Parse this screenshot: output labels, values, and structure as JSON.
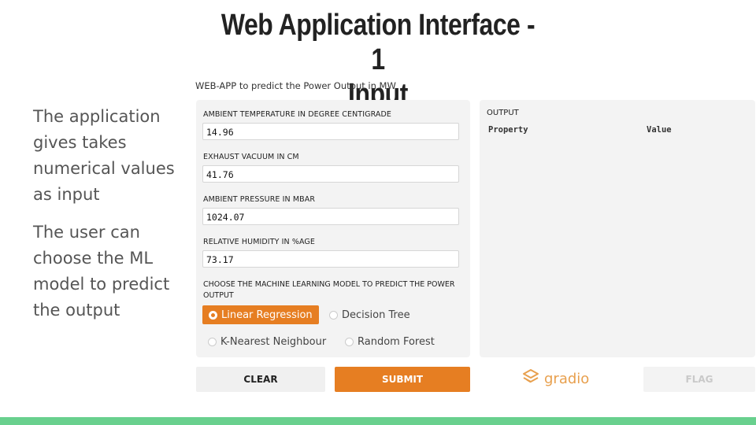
{
  "slide": {
    "title_line1": "Web Application Interface - 1",
    "title_line2": "Input",
    "side_text": [
      "The application gives takes numerical values as input",
      "The user can choose the ML model to predict the output"
    ]
  },
  "app": {
    "subtitle": "WEB-APP to predict the Power Output in MW",
    "inputs": [
      {
        "label": "AMBIENT TEMPERATURE IN DEGREE CENTIGRADE",
        "value": "14.96"
      },
      {
        "label": "EXHAUST VACUUM IN CM",
        "value": "41.76"
      },
      {
        "label": "AMBIENT PRESSURE IN MBAR",
        "value": "1024.07"
      },
      {
        "label": "RELATIVE HUMIDITY IN %AGE",
        "value": "73.17"
      }
    ],
    "model_choice": {
      "label": "CHOOSE THE MACHINE LEARNING MODEL TO PREDICT THE POWER OUTPUT",
      "options": [
        "Linear Regression",
        "Decision Tree",
        "K-Nearest Neighbour",
        "Random Forest"
      ],
      "selected": "Linear Regression"
    },
    "output": {
      "label": "OUTPUT",
      "columns": [
        "Property",
        "Value"
      ]
    },
    "buttons": {
      "clear": "CLEAR",
      "submit": "SUBMIT",
      "flag": "FLAG"
    },
    "brand": "gradio"
  },
  "colors": {
    "accent": "#e67e22",
    "bottom_bar": "#69d08e"
  }
}
